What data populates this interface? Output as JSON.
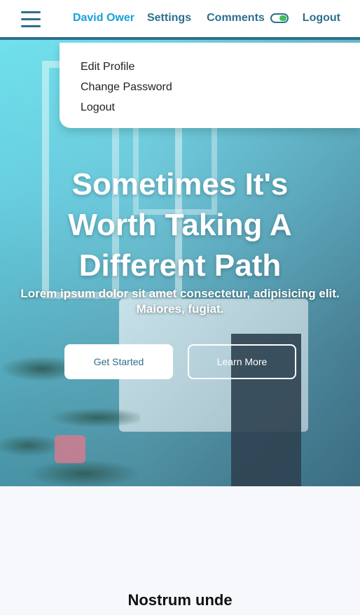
{
  "nav": {
    "user": "David Ower",
    "settings": "Settings",
    "comments": "Comments",
    "logout": "Logout",
    "comments_toggle_on": true
  },
  "dropdown": {
    "items": [
      {
        "label": "Edit Profile"
      },
      {
        "label": "Change Password"
      },
      {
        "label": "Logout"
      }
    ]
  },
  "hero": {
    "title": "Sometimes It's Worth Taking A Different Path",
    "subtitle": "Lorem ipsum dolor sit amet consectetur, adipisicing elit. Maiores, fugiat.",
    "primary_button": "Get Started",
    "secondary_button": "Learn More"
  },
  "section": {
    "title": "Nostrum unde"
  },
  "colors": {
    "accent": "#2e6f8e",
    "user_link": "#1aa0d8",
    "toggle_on": "#3fbf5a"
  }
}
